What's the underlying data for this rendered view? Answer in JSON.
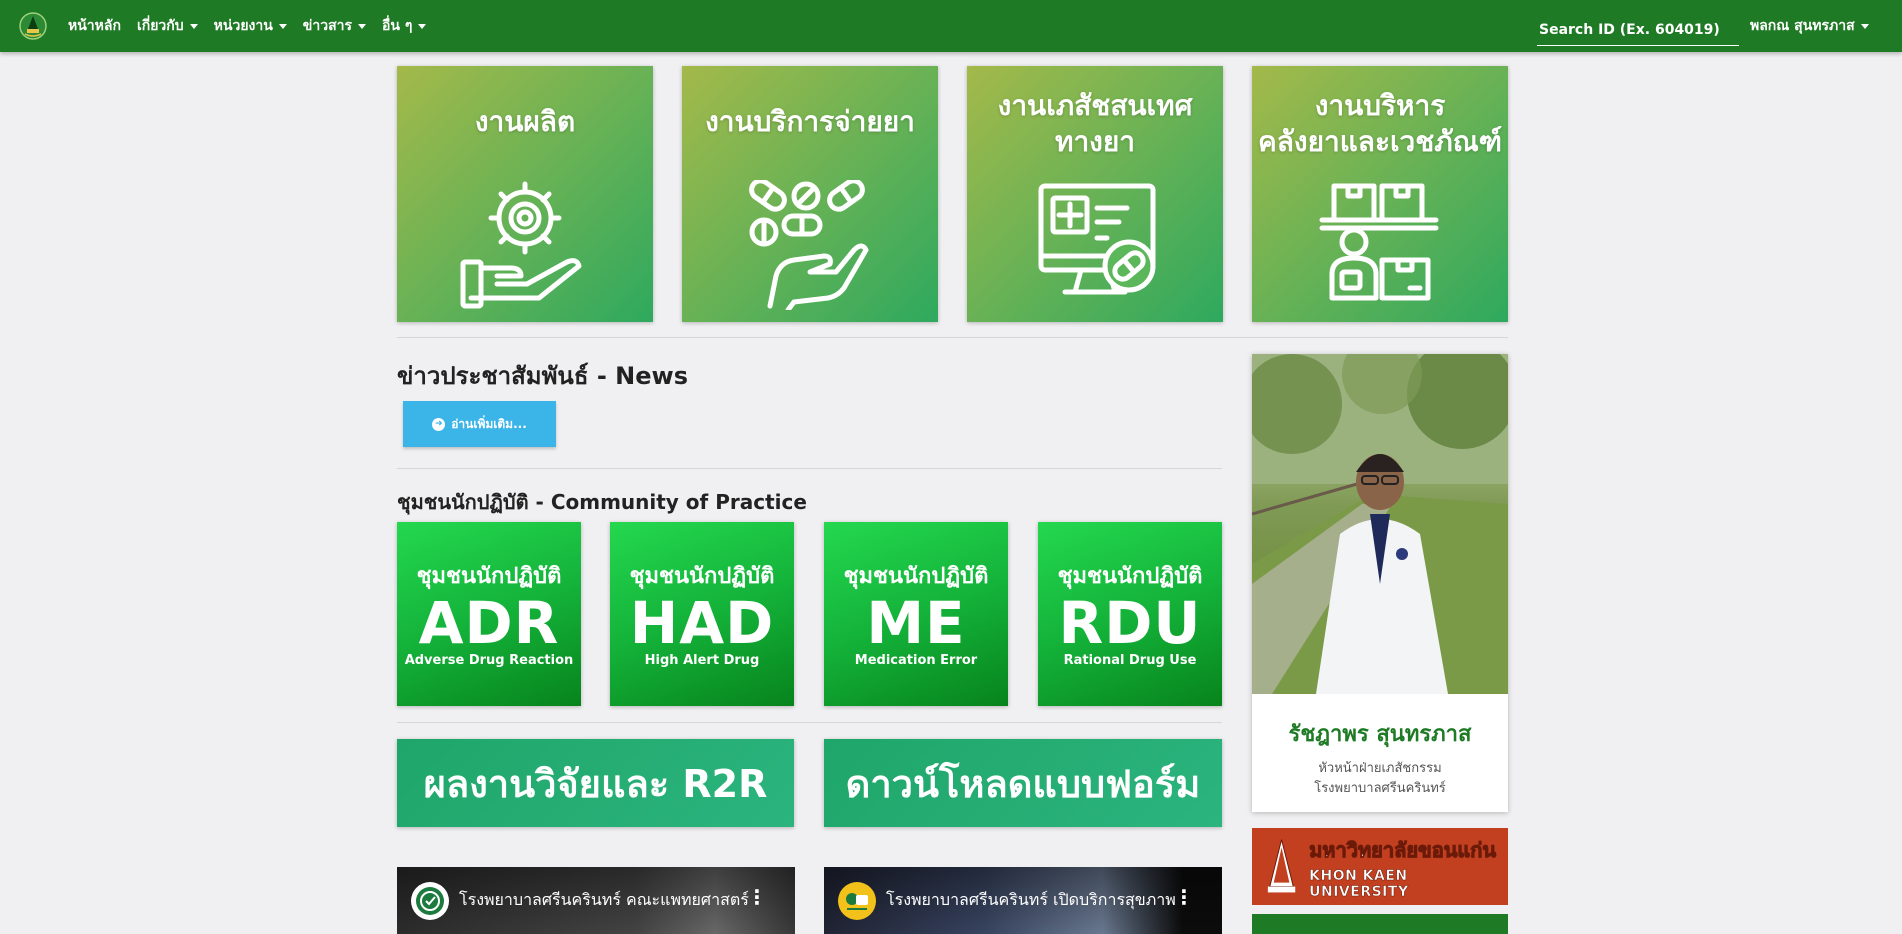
{
  "navbar": {
    "logo_icon": "hospital-emblem-icon",
    "items": [
      {
        "label": "หน้าหลัก",
        "dropdown": false
      },
      {
        "label": "เกี่ยวกับ",
        "dropdown": true
      },
      {
        "label": "หน่วยงาน",
        "dropdown": true
      },
      {
        "label": "ข่าวสาร",
        "dropdown": true
      },
      {
        "label": "อื่น ๆ",
        "dropdown": true
      }
    ],
    "search_placeholder": "Search ID (Ex. 604019)",
    "user_name": "พลกณ สุนทรภาส"
  },
  "departments": [
    {
      "title": "งานผลิต",
      "icon": "gear-hand-icon"
    },
    {
      "title": "งานบริการจ่ายยา",
      "icon": "pills-hand-icon"
    },
    {
      "title_line1": "งานเภสัชสนเทศ",
      "title_line2": "ทางยา",
      "icon": "medical-computer-icon"
    },
    {
      "title_line1": "งานบริหาร",
      "title_line2": "คลังยาและเวชภัณฑ์",
      "icon": "warehouse-worker-icon"
    }
  ],
  "news": {
    "title": "ข่าวประชาสัมพันธ์ - News",
    "read_more": "อ่านเพิ่มเติม..."
  },
  "community": {
    "title": "ชุมชนนักปฏิบัติ - Community of Practice",
    "tiles": [
      {
        "top": "ชุมชนนักปฏิบัติ",
        "code": "ADR",
        "sub": "Adverse Drug Reaction"
      },
      {
        "top": "ชุมชนนักปฏิบัติ",
        "code": "HAD",
        "sub": "High Alert Drug"
      },
      {
        "top": "ชุมชนนักปฏิบัติ",
        "code": "ME",
        "sub": "Medication Error"
      },
      {
        "top": "ชุมชนนักปฏิบัติ",
        "code": "RDU",
        "sub": "Rational Drug Use"
      }
    ]
  },
  "banners": {
    "research": "ผลงานวิจัยและ R2R",
    "download": "ดาวน์โหลดแบบฟอร์ม"
  },
  "videos": [
    {
      "title": "โรงพยาบาลศรีนครินทร์ คณะแพทยศาสตร์",
      "channel_icon": "hospital-logo-icon"
    },
    {
      "title": "โรงพยาบาลศรีนครินทร์ เปิดบริการสุขภาพ",
      "channel_icon": "channel-avatar-icon"
    }
  ],
  "profile": {
    "name": "รัชฎาพร สุนทรภาส",
    "role_line1": "หัวหน้าฝ่ายเภสัชกรรม",
    "role_line2": "โรงพยาบาลศรีนครินทร์"
  },
  "kku": {
    "thai": "มหาวิทยาลัยขอนแก่น",
    "english": "KHON KAEN UNIVERSITY"
  },
  "colors": {
    "navbar": "#1f7a25",
    "info_button": "#3bb4e8",
    "profile_name": "#1f7a25",
    "kku_banner": "#c2401f"
  }
}
